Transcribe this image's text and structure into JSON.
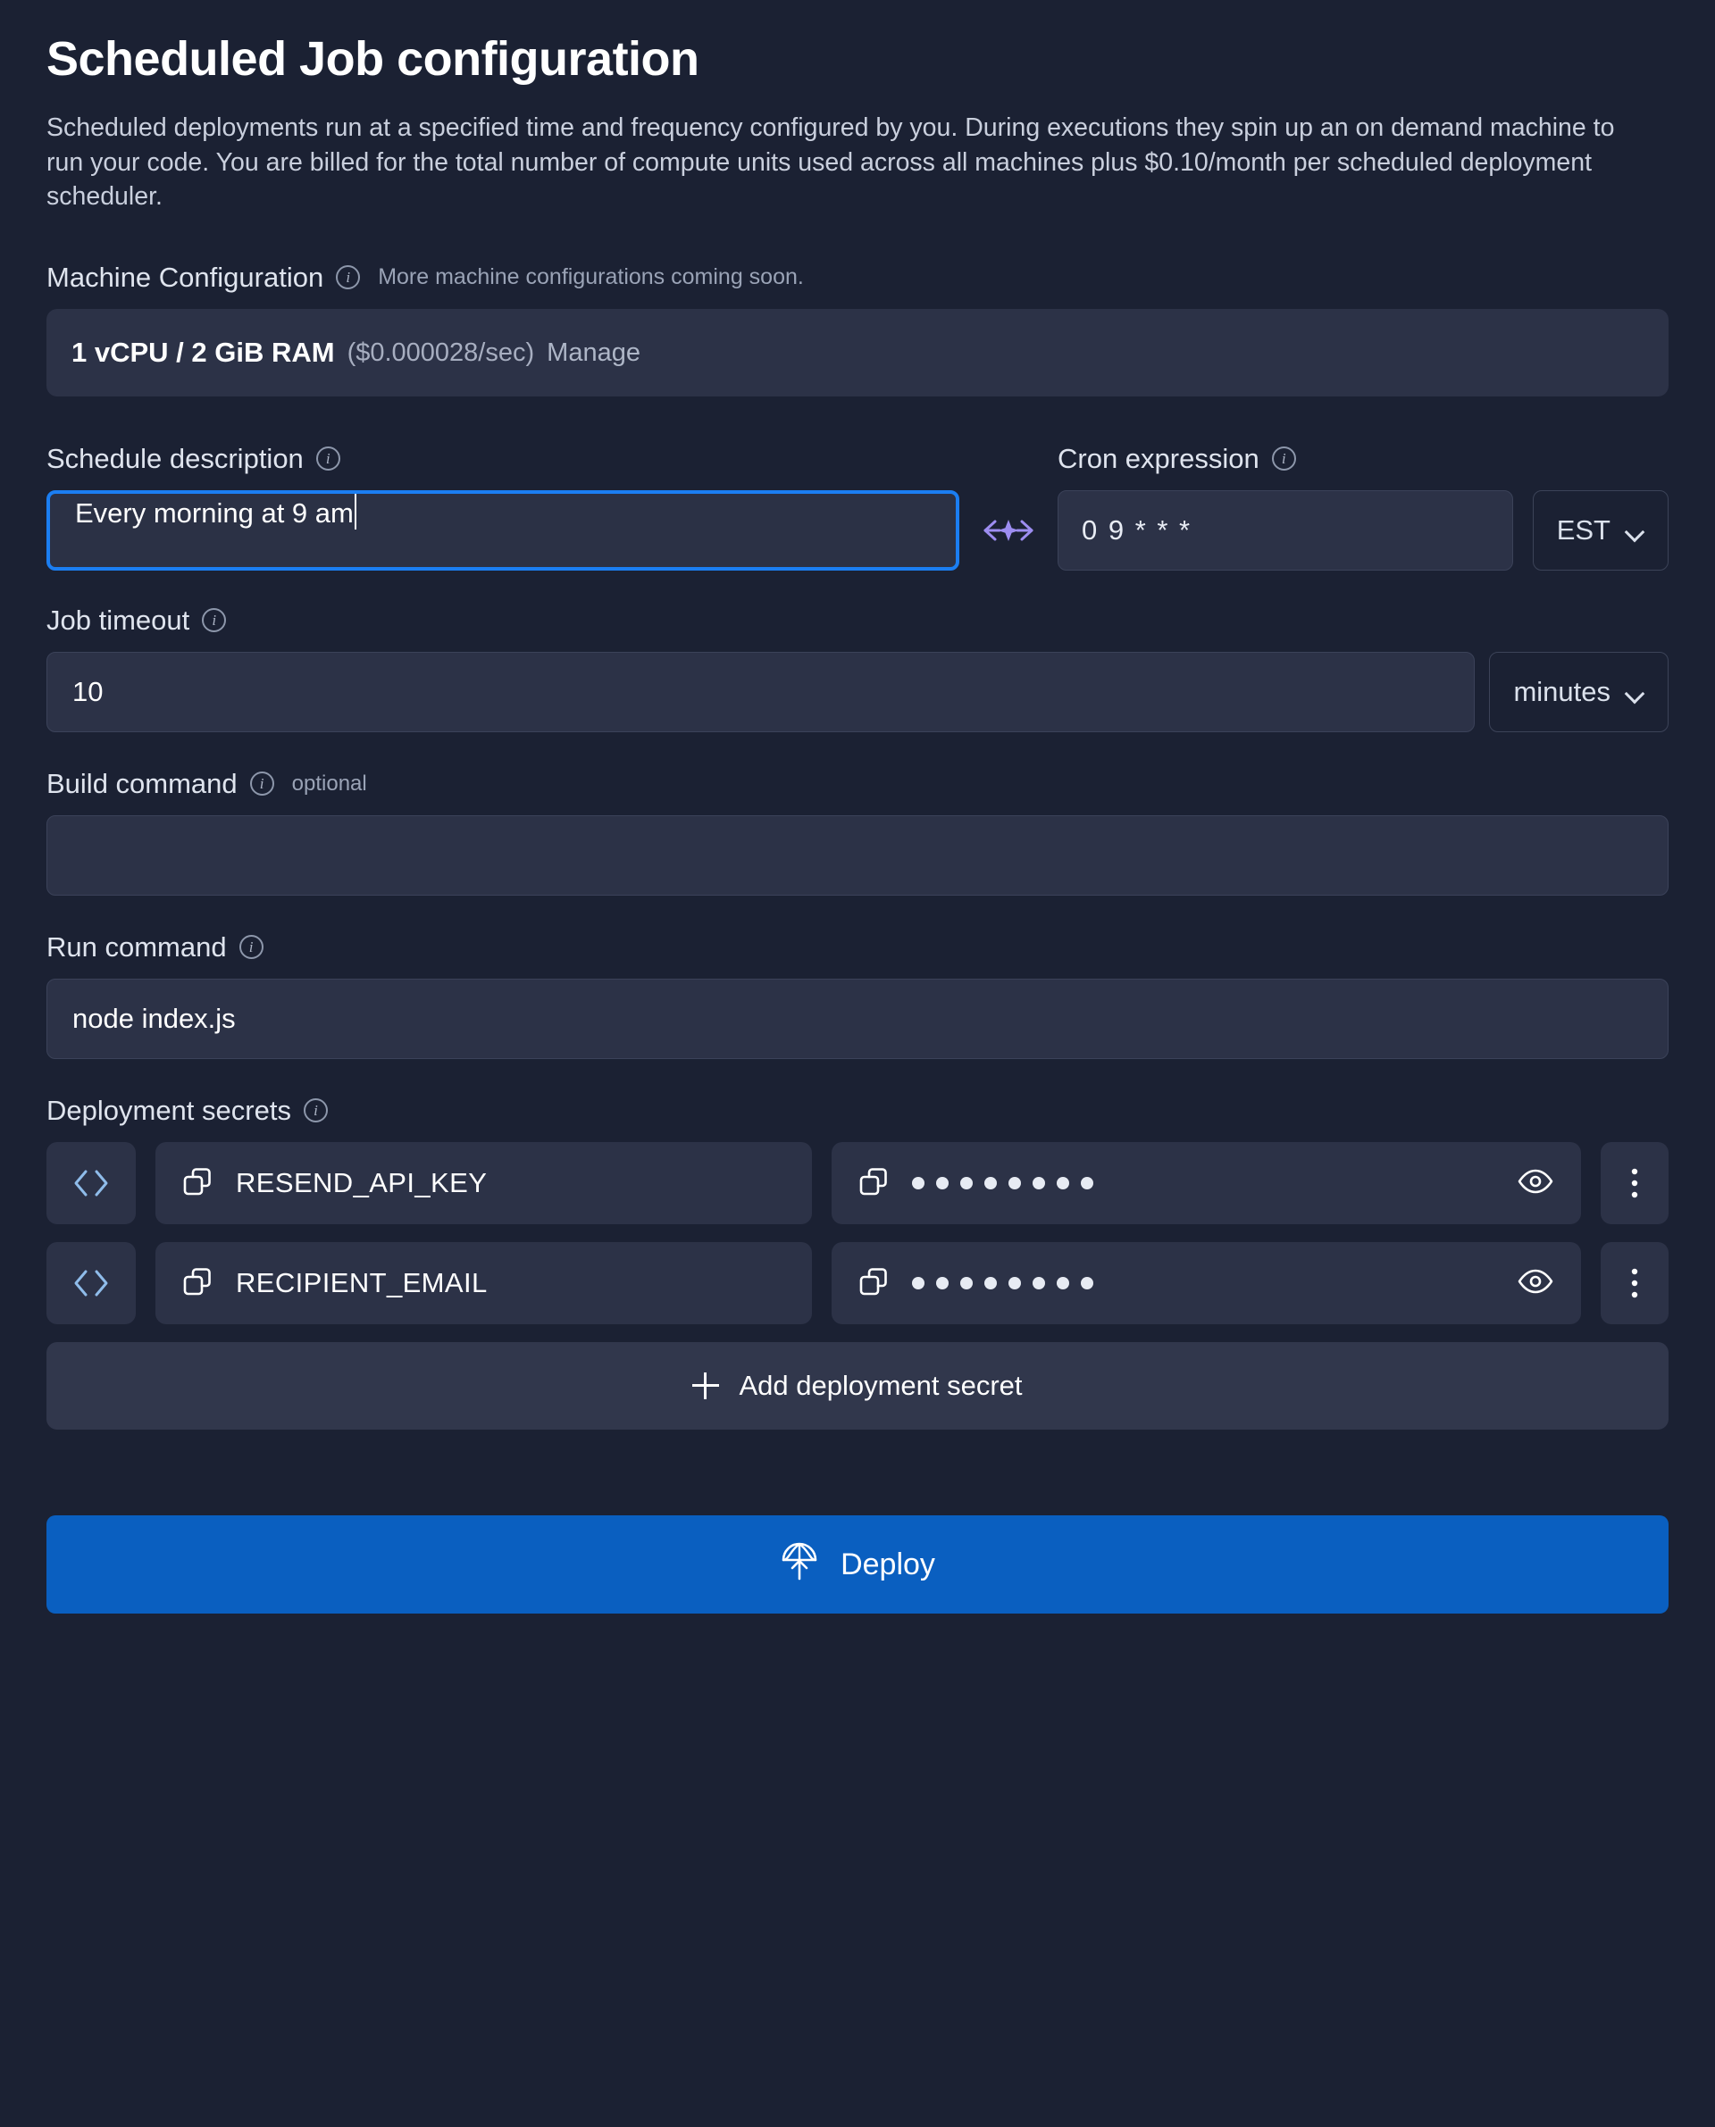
{
  "page": {
    "title": "Scheduled Job configuration",
    "description": "Scheduled deployments run at a specified time and frequency configured by you. During executions they spin up an on demand machine to run your code. You are billed for the total number of compute units used across all machines plus $0.10/month per scheduled deployment scheduler."
  },
  "machine": {
    "label": "Machine Configuration",
    "hint": "More machine configurations coming soon.",
    "name": "1 vCPU / 2 GiB RAM",
    "price": "($0.000028/sec)",
    "manage_label": "Manage"
  },
  "schedule": {
    "label": "Schedule description",
    "value": "Every morning at 9 am",
    "placeholder": "",
    "magic_icon": "arrows-sparkle-icon"
  },
  "cron": {
    "label": "Cron expression",
    "value": "0 9 * * *",
    "placeholder": "",
    "timezone": "EST"
  },
  "timeout": {
    "label": "Job timeout",
    "value": "10",
    "unit": "minutes"
  },
  "build_command": {
    "label": "Build command",
    "optional_label": "optional",
    "value": "",
    "placeholder": ""
  },
  "run_command": {
    "label": "Run command",
    "value": "node index.js",
    "placeholder": ""
  },
  "secrets": {
    "label": "Deployment secrets",
    "items": [
      {
        "name": "RESEND_API_KEY",
        "value_masked": "••••••••"
      },
      {
        "name": "RECIPIENT_EMAIL",
        "value_masked": "••••••••"
      }
    ],
    "mask_dot_count": 8,
    "add_label": "Add deployment secret"
  },
  "deploy": {
    "label": "Deploy",
    "icon": "parachute-icon"
  },
  "colors": {
    "page_bg": "#1b2133",
    "field_bg": "#2c3247",
    "focus_border": "#1b7ef2",
    "deploy_bg": "#0a5fc0",
    "accent_purple": "#9d8df1",
    "code_icon_blue": "#8fbcea"
  }
}
